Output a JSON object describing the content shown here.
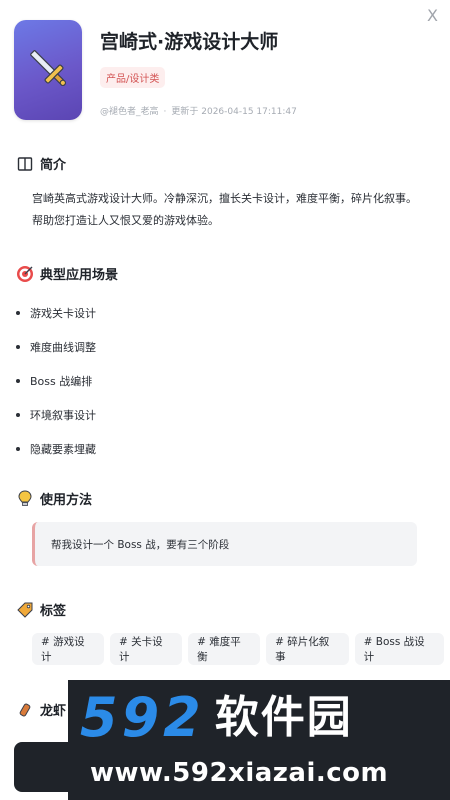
{
  "close_label": "X",
  "app": {
    "title": "宫崎式·游戏设计大师",
    "category": "产品/设计类",
    "author": "@褪色者_老高",
    "separator": "·",
    "updated": "更新于 2026-04-15 17:11:47"
  },
  "sections": {
    "intro_title": "简介",
    "intro_text": "宫崎英高式游戏设计大师。冷静深沉，擅长关卡设计，难度平衡，碎片化叙事。帮助您打造让人又恨又爱的游戏体验。",
    "scenarios_title": "典型应用场景",
    "scenarios": [
      "游戏关卡设计",
      "难度曲线调整",
      "Boss 战编排",
      "环境叙事设计",
      "隐藏要素埋藏"
    ],
    "usage_title": "使用方法",
    "usage_example": "帮我设计一个 Boss 战，要有三个阶段",
    "tags_title": "标签",
    "tags": [
      "# 游戏设计",
      "# 关卡设计",
      "# 难度平衡",
      "# 碎片化叙事",
      "# Boss 战设计"
    ],
    "next_title_partial": "龙虾"
  },
  "watermark": {
    "number": "592",
    "name": "软件园",
    "url": "www.592xiazai.com"
  },
  "icons": {
    "app": "sword-icon",
    "intro": "book-icon",
    "scenarios": "target-icon",
    "usage": "lightbulb-icon",
    "tags": "tag-icon",
    "next": "candy-icon"
  },
  "colors": {
    "app_icon_gradient": [
      "#6d79e6",
      "#5b45b3"
    ],
    "category_bg": "#fdeeee",
    "category_text": "#d35353",
    "usage_border": "#e7a4a4",
    "watermark_blue": "#2b8be8"
  }
}
